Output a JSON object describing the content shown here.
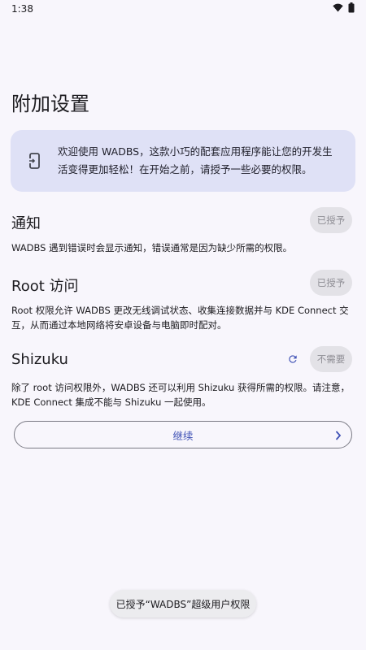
{
  "status_bar": {
    "time": "1:38"
  },
  "page": {
    "title": "附加设置"
  },
  "welcome": {
    "text": "欢迎使用 WADBS，这款小巧的配套应用程序能让您的开发生活变得更加轻松！在开始之前，请授予一些必要的权限。"
  },
  "sections": [
    {
      "title": "通知",
      "description": "WADBS 遇到错误时会显示通知，错误通常是因为缺少所需的权限。",
      "status": "已授予"
    },
    {
      "title": "Root 访问",
      "description": "Root 权限允许 WADBS 更改无线调试状态、收集连接数据并与 KDE Connect 交互，从而通过本地网络将安卓设备与电脑即时配对。",
      "status": "已授予"
    },
    {
      "title": "Shizuku",
      "description": "除了 root 访问权限外，WADBS 还可以利用 Shizuku 获得所需的权限。请注意，KDE Connect 集成不能与 Shizuku 一起使用。",
      "status": "不需要"
    }
  ],
  "continue_button": {
    "label": "继续"
  },
  "toast": {
    "text": "已授予“WADBS”超级用户权限"
  },
  "colors": {
    "accent": "#3f51b5",
    "card_bg": "#dfe1f6",
    "pill_bg": "#e3e2e7"
  },
  "icons": {
    "welcome": "phone-link-icon",
    "refresh": "refresh-icon",
    "chevron": "chevron-right-icon",
    "wifi": "wifi-icon",
    "battery": "battery-icon"
  }
}
